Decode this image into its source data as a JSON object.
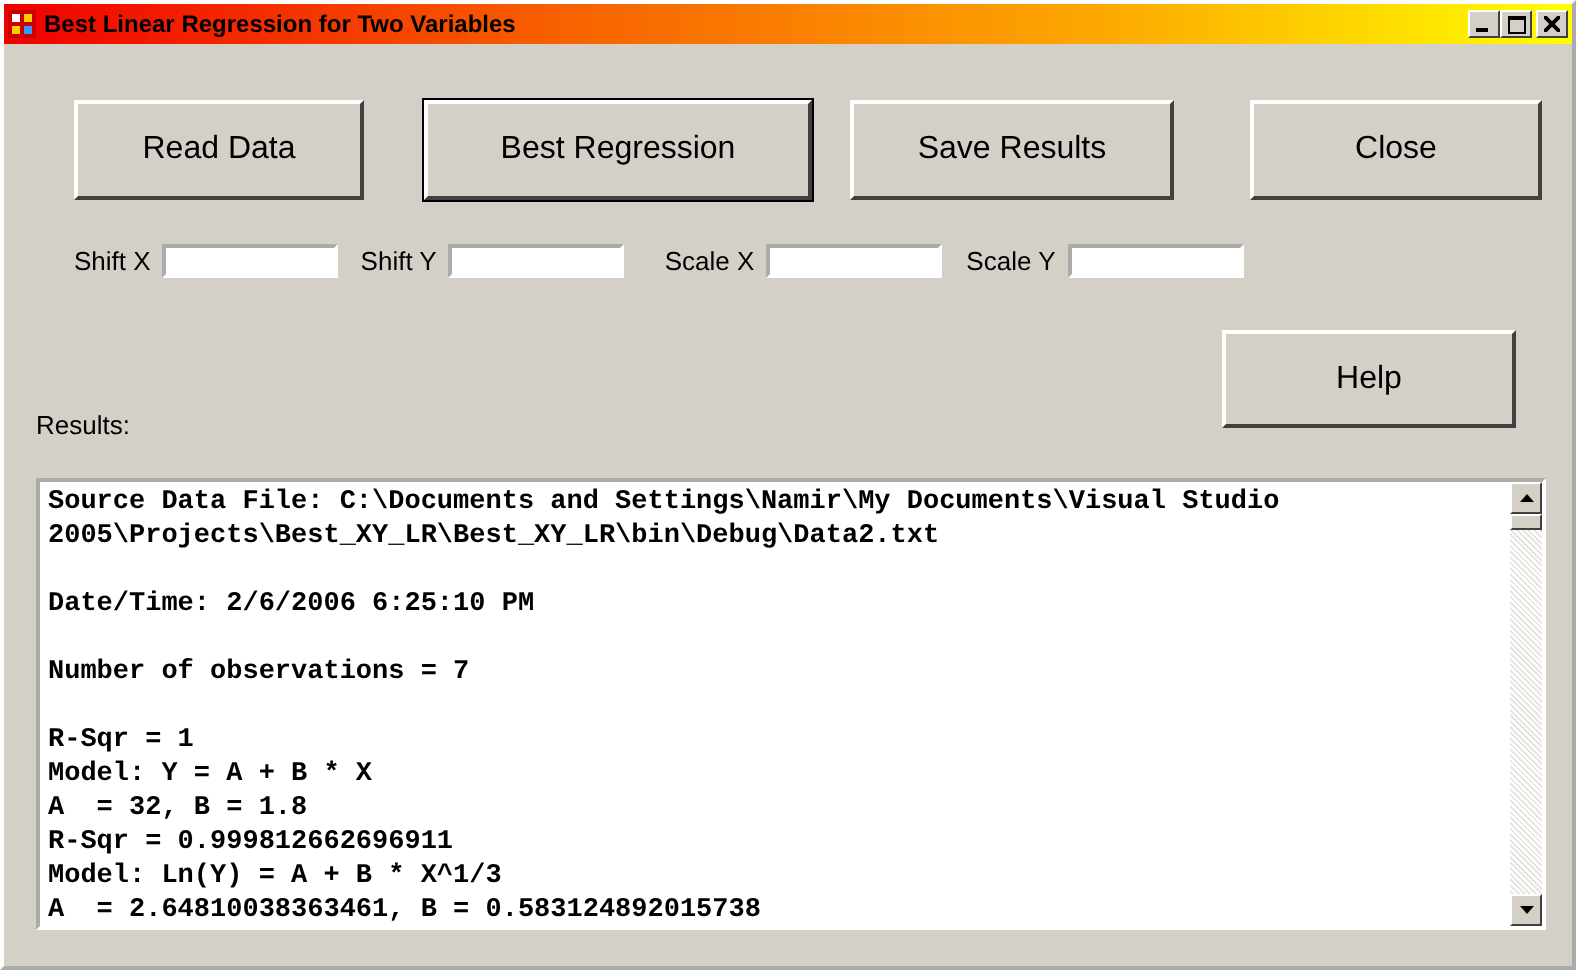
{
  "window": {
    "title": "Best Linear Regression for Two Variables"
  },
  "buttons": [
    {
      "label": "Read Data",
      "focused": false
    },
    {
      "label": "Best Regression",
      "focused": true
    },
    {
      "label": "Save Results",
      "focused": false
    },
    {
      "label": "Close",
      "focused": false
    }
  ],
  "fields": [
    {
      "label": "Shift X"
    },
    {
      "label": "Shift Y"
    },
    {
      "label": "Scale X"
    },
    {
      "label": "Scale Y"
    }
  ],
  "help_button": {
    "label": "Help"
  },
  "results": {
    "label": "Results:",
    "paragraphs": [
      [
        "Source Data File: C:\\Documents and Settings\\Namir\\My Documents\\Visual Studio",
        "2005\\Projects\\Best_XY_LR\\Best_XY_LR\\bin\\Debug\\Data2.txt"
      ],
      [
        "Date/Time: 2/6/2006 6:25:10 PM"
      ],
      [
        "Number of observations = 7"
      ],
      [
        "R-Sqr = 1",
        "Model: Y = A + B * X",
        "A  = 32, B = 1.8",
        "R-Sqr = 0.999812662696911",
        "Model: Ln(Y) = A + B * X^1/3",
        "A  = 2.64810038363461, B = 0.583124892015738"
      ]
    ]
  }
}
